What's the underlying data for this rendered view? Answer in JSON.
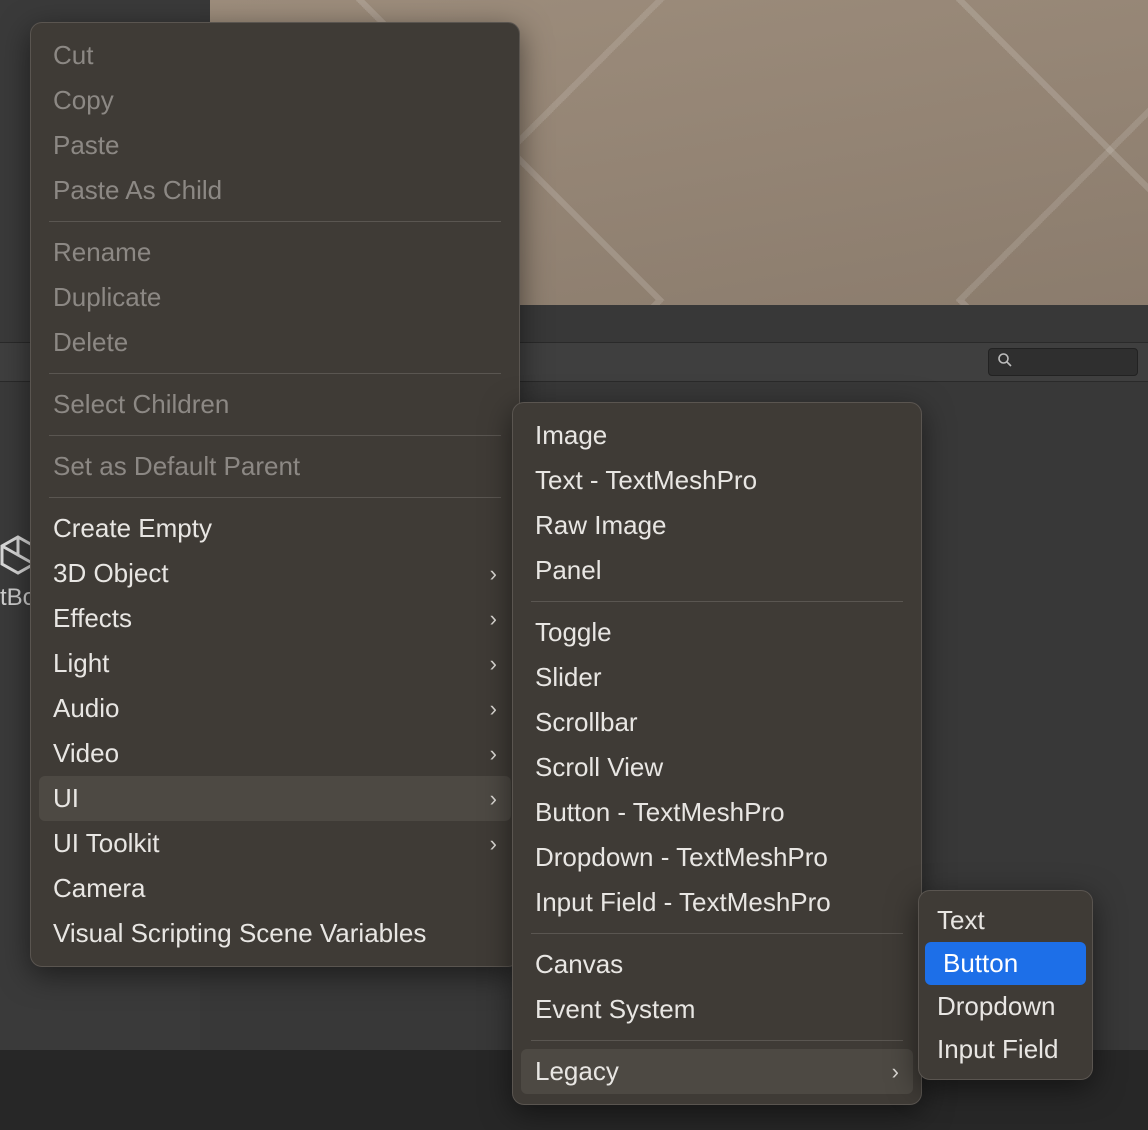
{
  "main_menu": {
    "groups": [
      [
        {
          "label": "Cut",
          "disabled": true
        },
        {
          "label": "Copy",
          "disabled": true
        },
        {
          "label": "Paste",
          "disabled": true
        },
        {
          "label": "Paste As Child",
          "disabled": true
        }
      ],
      [
        {
          "label": "Rename",
          "disabled": true
        },
        {
          "label": "Duplicate",
          "disabled": true
        },
        {
          "label": "Delete",
          "disabled": true
        }
      ],
      [
        {
          "label": "Select Children",
          "disabled": true
        }
      ],
      [
        {
          "label": "Set as Default Parent",
          "disabled": true
        }
      ],
      [
        {
          "label": "Create Empty"
        },
        {
          "label": "3D Object",
          "submenu": true
        },
        {
          "label": "Effects",
          "submenu": true
        },
        {
          "label": "Light",
          "submenu": true
        },
        {
          "label": "Audio",
          "submenu": true
        },
        {
          "label": "Video",
          "submenu": true
        },
        {
          "label": "UI",
          "submenu": true,
          "highlighted": true
        },
        {
          "label": "UI Toolkit",
          "submenu": true
        },
        {
          "label": "Camera"
        },
        {
          "label": "Visual Scripting Scene Variables"
        }
      ]
    ]
  },
  "ui_submenu": {
    "groups": [
      [
        {
          "label": "Image"
        },
        {
          "label": "Text - TextMeshPro"
        },
        {
          "label": "Raw Image"
        },
        {
          "label": "Panel"
        }
      ],
      [
        {
          "label": "Toggle"
        },
        {
          "label": "Slider"
        },
        {
          "label": "Scrollbar"
        },
        {
          "label": "Scroll View"
        },
        {
          "label": "Button - TextMeshPro"
        },
        {
          "label": "Dropdown - TextMeshPro"
        },
        {
          "label": "Input Field - TextMeshPro"
        }
      ],
      [
        {
          "label": "Canvas"
        },
        {
          "label": "Event System"
        }
      ],
      [
        {
          "label": "Legacy",
          "submenu": true,
          "highlighted": true
        }
      ]
    ]
  },
  "legacy_submenu": {
    "items": [
      {
        "label": "Text"
      },
      {
        "label": "Button",
        "selected": true
      },
      {
        "label": "Dropdown"
      },
      {
        "label": "Input Field"
      }
    ]
  },
  "sidebar": {
    "partial_label": "tBo"
  },
  "search": {
    "placeholder": ""
  }
}
